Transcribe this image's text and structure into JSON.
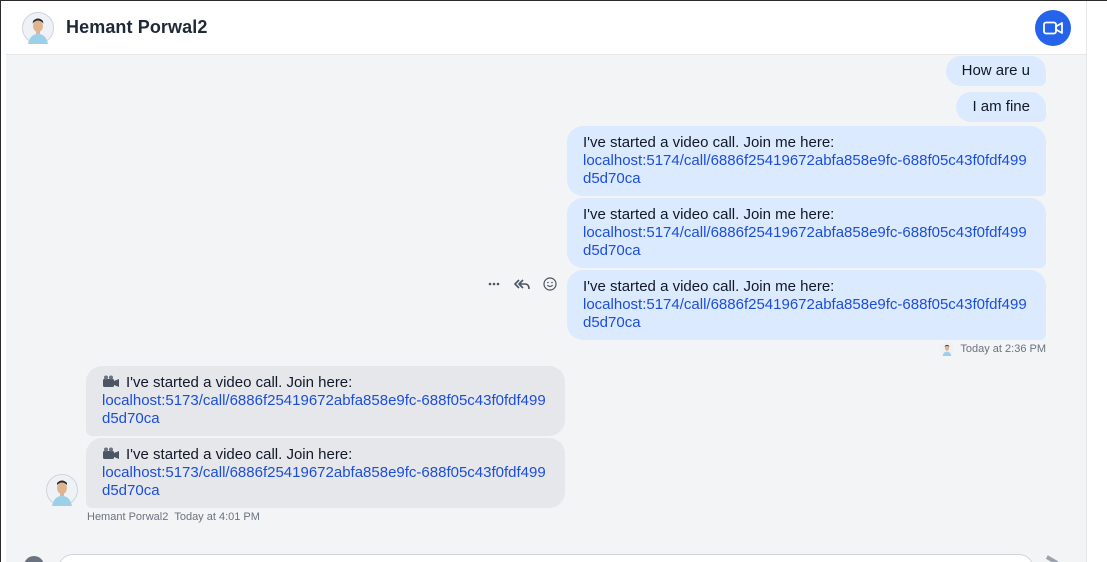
{
  "header": {
    "title": "Hemant Porwal2",
    "avatar_icon": "user-avatar-icon",
    "video_call_icon": "video-camera-icon",
    "accent_color": "#2563eb"
  },
  "messages": {
    "outgoing": [
      {
        "text": "How are u"
      },
      {
        "text": "I am fine"
      },
      {
        "text": "I've started a video call. Join me here:",
        "link": "localhost:5174/call/6886f25419672abfa858e9fc-688f05c43f0fdf499d5d70ca"
      },
      {
        "text": "I've started a video call. Join me here:",
        "link": "localhost:5174/call/6886f25419672abfa858e9fc-688f05c43f0fdf499d5d70ca"
      },
      {
        "text": "I've started a video call. Join me here:",
        "link": "localhost:5174/call/6886f25419672abfa858e9fc-688f05c43f0fdf499d5d70ca"
      }
    ],
    "outgoing_meta": "Today at 2:36 PM",
    "incoming": [
      {
        "text": "I've started a video call. Join here:",
        "link": "localhost:5173/call/6886f25419672abfa858e9fc-688f05c43f0fdf499d5d70ca",
        "icon": "video-camera-emoji-icon"
      },
      {
        "text": "I've started a video call. Join here:",
        "link": "localhost:5173/call/6886f25419672abfa858e9fc-688f05c43f0fdf499d5d70ca",
        "icon": "video-camera-emoji-icon"
      }
    ],
    "incoming_meta": {
      "sender": "Hemant Porwal2",
      "time": "Today at 4:01 PM"
    }
  },
  "hover_actions": {
    "more_icon": "more-horizontal-icon",
    "reply_all_icon": "reply-all-icon",
    "emoji_icon": "smiley-icon"
  },
  "colors": {
    "outgoing_bubble": "#dbeafe",
    "incoming_bubble": "#e5e7eb",
    "link": "#1d4ed8",
    "chat_background": "#f3f4f6"
  }
}
